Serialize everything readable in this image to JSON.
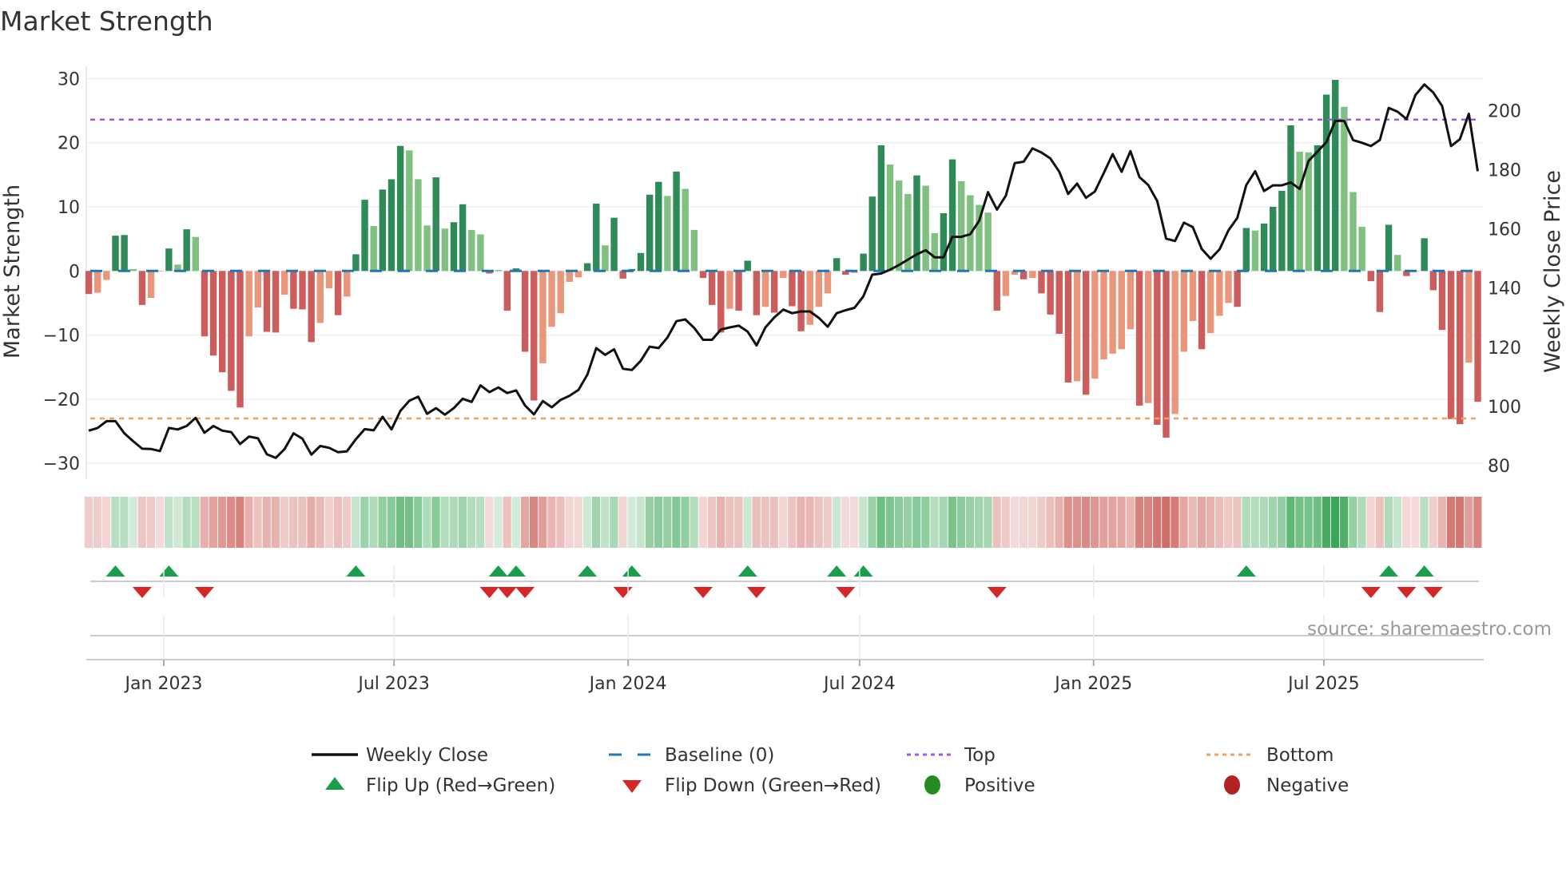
{
  "chart_data": {
    "type": "bar",
    "title": "Market Strength",
    "ylabel": "Market Strength",
    "y2label": "Weekly Close Price",
    "ylim": [
      -30,
      30
    ],
    "y2lim": [
      80,
      200
    ],
    "yticks": [
      -30,
      -20,
      -10,
      0,
      10,
      20,
      30
    ],
    "y2ticks": [
      80,
      100,
      120,
      140,
      160,
      180,
      200
    ],
    "xticks": [
      {
        "label": "Jan 2023",
        "date": "2023-01-01"
      },
      {
        "label": "Jul 2023",
        "date": "2023-07-01"
      },
      {
        "label": "Jan 2024",
        "date": "2024-01-01"
      },
      {
        "label": "Jul 2024",
        "date": "2024-07-01"
      },
      {
        "label": "Jan 2025",
        "date": "2025-01-01"
      },
      {
        "label": "Jul 2025",
        "date": "2025-07-01"
      }
    ],
    "start_date": "2022-11-03",
    "interval_days": 7,
    "top_level": 23.6,
    "bottom_level": -23.0,
    "baseline": 0,
    "grid": true,
    "legend_position": "bottom",
    "strength": [
      -3.6,
      -3.4,
      -1.4,
      5.5,
      5.6,
      0.3,
      -5.3,
      -4.2,
      -0.1,
      3.5,
      1.0,
      6.5,
      5.3,
      -10.2,
      -13.2,
      -15.8,
      -18.7,
      -21.3,
      -10.2,
      -5.7,
      -9.5,
      -9.6,
      -3.7,
      -5.9,
      -6.0,
      -11.1,
      -8.1,
      -2.7,
      -6.9,
      -4.0,
      2.6,
      11.1,
      7.0,
      12.7,
      14.3,
      19.5,
      18.8,
      14.3,
      7.1,
      14.6,
      6.6,
      7.6,
      10.4,
      6.4,
      5.7,
      -0.4,
      0.1,
      -6.2,
      0.4,
      -12.6,
      -20.2,
      -14.4,
      -8.7,
      -6.6,
      -1.7,
      -1.0,
      1.2,
      10.5,
      4.0,
      8.3,
      -1.2,
      0.3,
      2.8,
      11.9,
      13.9,
      11.7,
      15.5,
      12.8,
      6.4,
      -1.1,
      -5.3,
      -9.6,
      -5.9,
      -6.2,
      1.6,
      -6.9,
      -5.6,
      -6.5,
      -1.1,
      -5.5,
      -9.4,
      -8.4,
      -5.6,
      -3.5,
      2.0,
      -0.6,
      -0.3,
      2.7,
      11.6,
      19.6,
      16.6,
      14.1,
      12.0,
      14.9,
      13.3,
      5.9,
      9.0,
      17.4,
      14.0,
      11.8,
      10.3,
      9.1,
      -6.2,
      -3.9,
      -0.6,
      -1.3,
      -1.1,
      -3.5,
      -6.8,
      -9.8,
      -17.4,
      -17.2,
      -19.3,
      -16.8,
      -13.8,
      -12.9,
      -12.2,
      -9.1,
      -21.0,
      -20.6,
      -24.0,
      -26.0,
      -22.3,
      -12.6,
      -7.8,
      -12.2,
      -9.7,
      -7.0,
      -5.0,
      -5.6,
      6.7,
      6.3,
      7.4,
      10.0,
      12.5,
      22.7,
      18.6,
      18.5,
      19.6,
      27.5,
      29.8,
      25.6,
      12.3,
      6.9,
      -1.6,
      -6.4,
      7.2,
      2.5,
      -0.8,
      -0.1,
      5.1,
      -3.0,
      -9.2,
      -23.1,
      -23.9,
      -14.3,
      -20.4
    ],
    "weekly_close": [
      91.8,
      92.7,
      95.0,
      95.0,
      90.9,
      88.2,
      85.7,
      85.6,
      84.9,
      92.7,
      92.2,
      93.4,
      96.1,
      91.1,
      93.4,
      91.8,
      91.3,
      87.3,
      89.8,
      89.2,
      83.8,
      82.6,
      85.6,
      90.9,
      89.1,
      83.7,
      86.6,
      86.0,
      84.5,
      84.8,
      88.9,
      92.3,
      91.9,
      96.5,
      92.2,
      98.5,
      101.9,
      103.3,
      97.5,
      99.4,
      97.2,
      99.4,
      102.6,
      101.5,
      107.1,
      104.8,
      106.4,
      104.5,
      105.4,
      100.3,
      97.3,
      101.8,
      99.7,
      102.2,
      103.6,
      105.6,
      110.7,
      119.7,
      117.4,
      119.3,
      112.7,
      112.3,
      115.4,
      120.2,
      119.7,
      123.3,
      128.8,
      129.4,
      126.5,
      122.5,
      122.5,
      126.0,
      126.7,
      127.3,
      125.3,
      120.6,
      126.7,
      130.1,
      132.7,
      131.5,
      132.1,
      132.1,
      129.9,
      126.9,
      131.5,
      132.5,
      133.3,
      137.2,
      144.5,
      144.9,
      146.2,
      147.8,
      149.6,
      151.4,
      152.8,
      150.4,
      150.4,
      157.3,
      157.3,
      158.2,
      162.7,
      172.4,
      166.5,
      171.2,
      182.2,
      182.7,
      187.2,
      185.8,
      183.8,
      179.3,
      171.8,
      175.3,
      170.5,
      172.6,
      178.9,
      185.3,
      179.3,
      186.3,
      177.5,
      174.8,
      169.4,
      156.7,
      155.9,
      162.1,
      160.6,
      153.2,
      149.9,
      153.1,
      159.5,
      163.7,
      174.8,
      179.5,
      172.8,
      174.7,
      174.7,
      175.7,
      173.5,
      183.0,
      186.1,
      189.3,
      196.5,
      196.5,
      190.0,
      189.1,
      188.0,
      190.0,
      200.9,
      199.6,
      197.1,
      205.2,
      208.8,
      206.1,
      201.5,
      188.0,
      190.3,
      198.9,
      179.5
    ],
    "legend": [
      {
        "label": "Weekly Close",
        "kind": "line"
      },
      {
        "label": "Baseline (0)",
        "kind": "dash"
      },
      {
        "label": "Top",
        "kind": "dot-purple"
      },
      {
        "label": "Bottom",
        "kind": "dot-orange"
      },
      {
        "label": "Flip Up (Red→Green)",
        "kind": "tri-up"
      },
      {
        "label": "Flip Down (Green→Red)",
        "kind": "tri-down"
      },
      {
        "label": "Positive",
        "kind": "circle-green"
      },
      {
        "label": "Negative",
        "kind": "circle-red"
      }
    ],
    "source": "source: sharemaestro.com"
  },
  "colors": {
    "pos_strong": "#2e8b57",
    "pos_weak": "#80c080",
    "neg_strong": "#cd5c5c",
    "neg_weak": "#e9967a",
    "close": "#111111",
    "baseline": "#1f77b4",
    "top": "#a259e6",
    "bottom": "#f0a060",
    "flip_up": "#1a9e4a",
    "flip_down": "#d62728",
    "positive": "#228b22",
    "negative": "#b22222"
  }
}
